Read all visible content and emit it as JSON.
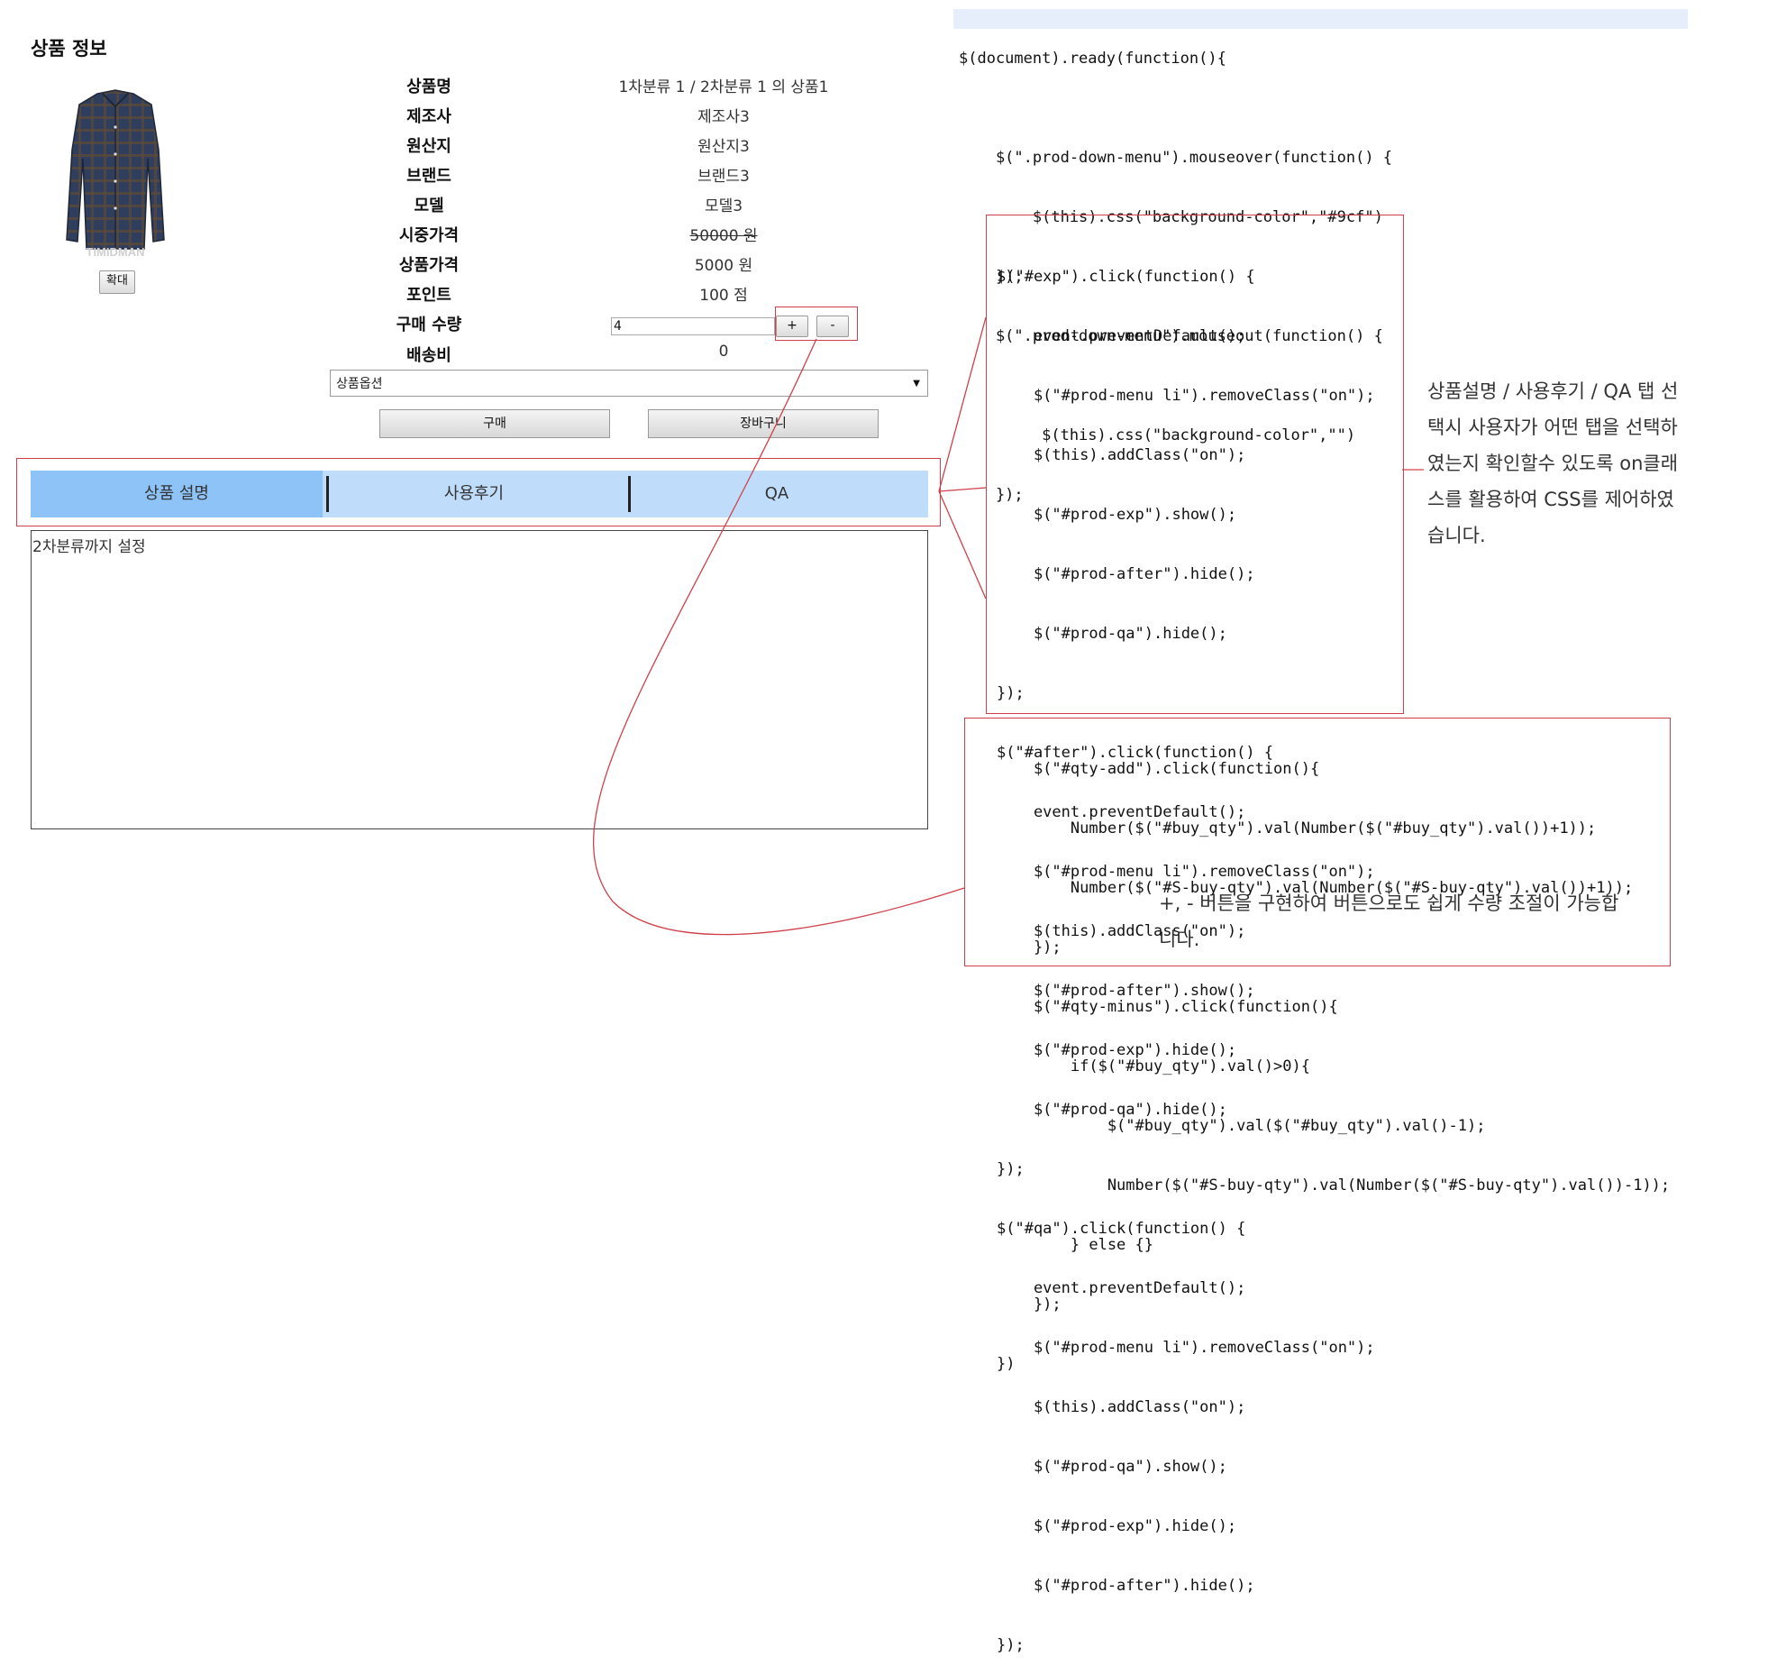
{
  "section_title": "상품 정보",
  "product_image": {
    "watermark": "TIMIDMAN"
  },
  "zoom_button": "확대",
  "product_info": [
    {
      "label": "상품명",
      "value": "1차분류 1 / 2차분류 1 의 상품1"
    },
    {
      "label": "제조사",
      "value": "제조사3"
    },
    {
      "label": "원산지",
      "value": "원산지3"
    },
    {
      "label": "브랜드",
      "value": "브랜드3"
    },
    {
      "label": "모델",
      "value": "모델3"
    },
    {
      "label": "시중가격",
      "value": "50000 원"
    },
    {
      "label": "상품가격",
      "value": "5000 원"
    },
    {
      "label": "포인트",
      "value": "100 점"
    },
    {
      "label": "구매 수량",
      "value": ""
    },
    {
      "label": "배송비",
      "value": "0"
    }
  ],
  "quantity": {
    "value": "4",
    "plus_label": "+",
    "minus_label": "-"
  },
  "option_select": {
    "selected": "상품옵션"
  },
  "actions": {
    "buy_label": "구매",
    "cart_label": "장바구니"
  },
  "tabs": [
    {
      "label": "상품 설명",
      "active": true
    },
    {
      "label": "사용후기",
      "active": false
    },
    {
      "label": "QA",
      "active": false
    }
  ],
  "tab_content": "2차분류까지 설정",
  "colors": {
    "active_tab": "#8ec3f8",
    "inactive_tab": "#bfdcfa",
    "annotation_red": "#d0404a",
    "code_keyword": "#6a0a7a",
    "code_string": "#2a3aa0"
  },
  "code_top": [
    "$(document).ready(function(){",
    "",
    "    $(\".prod-down-menu\").mouseover(function() {",
    "        $(this).css(\"background-color\",\"#9cf\")",
    "    });",
    "    $(\".prod-down-menu\").mouseout(function() {",
    "",
    "         $(this).css(\"background-color\",\"\")",
    "    });"
  ],
  "code_tabs": [
    "$(\"#exp\").click(function() {",
    "    event.preventDefault();",
    "    $(\"#prod-menu li\").removeClass(\"on\");",
    "    $(this).addClass(\"on\");",
    "    $(\"#prod-exp\").show();",
    "    $(\"#prod-after\").hide();",
    "    $(\"#prod-qa\").hide();",
    "});",
    "$(\"#after\").click(function() {",
    "    event.preventDefault();",
    "    $(\"#prod-menu li\").removeClass(\"on\");",
    "    $(this).addClass(\"on\");",
    "    $(\"#prod-after\").show();",
    "    $(\"#prod-exp\").hide();",
    "    $(\"#prod-qa\").hide();",
    "});",
    "$(\"#qa\").click(function() {",
    "    event.preventDefault();",
    "    $(\"#prod-menu li\").removeClass(\"on\");",
    "    $(this).addClass(\"on\");",
    "    $(\"#prod-qa\").show();",
    "    $(\"#prod-exp\").hide();",
    "    $(\"#prod-after\").hide();",
    "});"
  ],
  "code_qty": [
    "    $(\"#qty-add\").click(function(){",
    "        Number($(\"#buy_qty\").val(Number($(\"#buy_qty\").val())+1));",
    "        Number($(\"#S-buy-qty\").val(Number($(\"#S-buy-qty\").val())+1));",
    "    });",
    "    $(\"#qty-minus\").click(function(){",
    "        if($(\"#buy_qty\").val()>0){",
    "            $(\"#buy_qty\").val($(\"#buy_qty\").val()-1);",
    "            Number($(\"#S-buy-qty\").val(Number($(\"#S-buy-qty\").val())-1));",
    "        } else {}",
    "    });",
    "})"
  ],
  "note_tabs": [
    "상품설명 / 사용후기 / QA 탭 선",
    "택시 사용자가 어떤 탭을 선택하",
    "였는지 확인할수 있도록 on클래",
    "스를 활용하여 CSS를 제어하였",
    "습니다."
  ],
  "note_qty": [
    "+, - 버튼을 구현하여 버튼으로도 쉽게 수량 조절이 가능합",
    "니다."
  ]
}
